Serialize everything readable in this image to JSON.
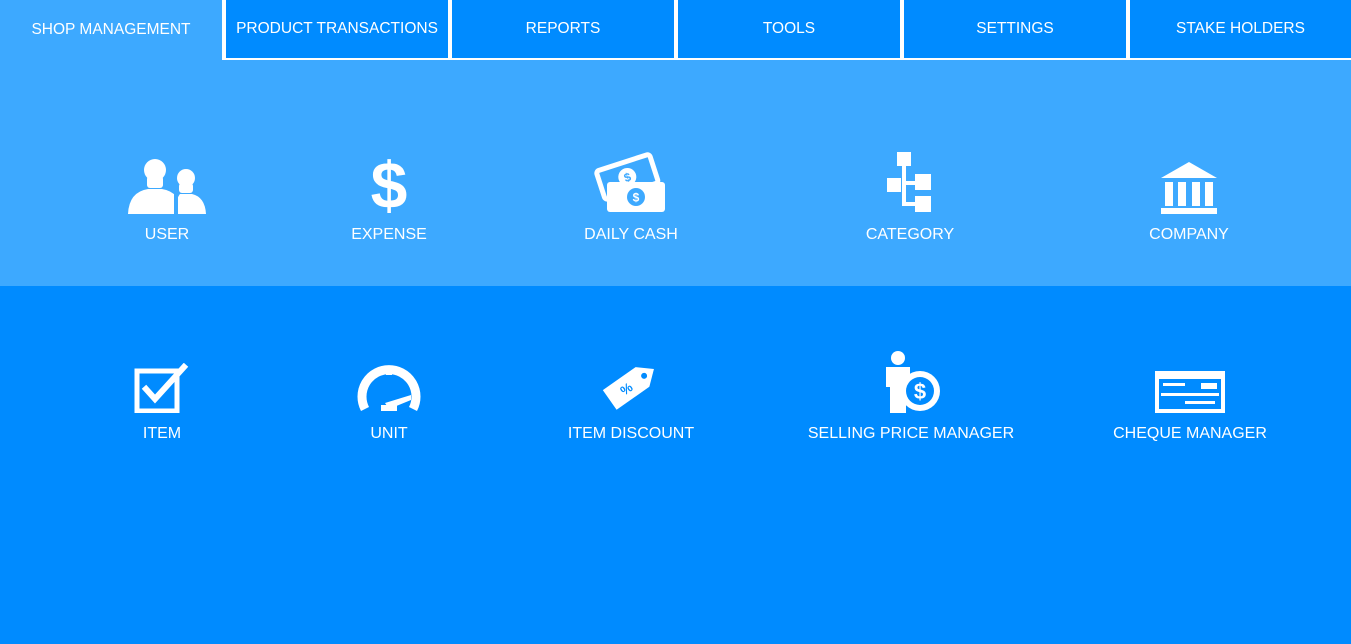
{
  "tabs": [
    {
      "label": "SHOP MANAGEMENT",
      "active": true
    },
    {
      "label": "PRODUCT TRANSACTIONS",
      "active": false
    },
    {
      "label": "REPORTS",
      "active": false
    },
    {
      "label": "TOOLS",
      "active": false
    },
    {
      "label": "SETTINGS",
      "active": false
    },
    {
      "label": "STAKE HOLDERS",
      "active": false
    }
  ],
  "row1": [
    {
      "label": "USER",
      "icon": "users-icon"
    },
    {
      "label": "EXPENSE",
      "icon": "dollar-icon"
    },
    {
      "label": "DAILY CASH",
      "icon": "cash-icon"
    },
    {
      "label": "CATEGORY",
      "icon": "category-tree-icon"
    },
    {
      "label": "COMPANY",
      "icon": "bank-icon"
    }
  ],
  "row2": [
    {
      "label": "ITEM",
      "icon": "checkbox-edit-icon"
    },
    {
      "label": "UNIT",
      "icon": "gauge-icon"
    },
    {
      "label": "ITEM DISCOUNT",
      "icon": "discount-tag-icon"
    },
    {
      "label": "SELLING PRICE MANAGER",
      "icon": "price-manager-icon"
    },
    {
      "label": "CHEQUE MANAGER",
      "icon": "cheque-icon"
    }
  ],
  "colors": {
    "tab_bg": "#008bff",
    "active_tab_bg": "#3da9ff",
    "top_panel": "#3da9ff",
    "bottom_panel": "#008bff",
    "text": "#ffffff"
  }
}
